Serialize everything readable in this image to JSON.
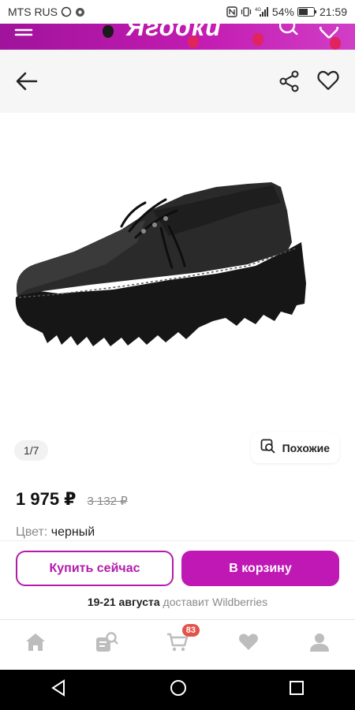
{
  "status_bar": {
    "carrier": "MTS RUS",
    "battery": "54%",
    "time": "21:59",
    "network": "4G"
  },
  "banner": {
    "brand": "Ягодки",
    "color": "#b21bac"
  },
  "gallery": {
    "pager": "1/7",
    "similar_label": "Похожие"
  },
  "product": {
    "price": "1 975 ₽",
    "old_price": "3 132 ₽",
    "color_label": "Цвет:",
    "color_value": "черный"
  },
  "actions": {
    "buy_now": "Купить сейчас",
    "add_to_cart": "В корзину",
    "delivery_dates": "19-21 августа",
    "delivery_text": "доставит Wildberries"
  },
  "tabbar": {
    "items": [
      "home-icon",
      "catalog-icon",
      "cart-icon",
      "favorites-icon",
      "profile-icon"
    ],
    "cart_count": "83"
  },
  "colors": {
    "accent": "#c018b4",
    "badge": "#e4534a"
  }
}
